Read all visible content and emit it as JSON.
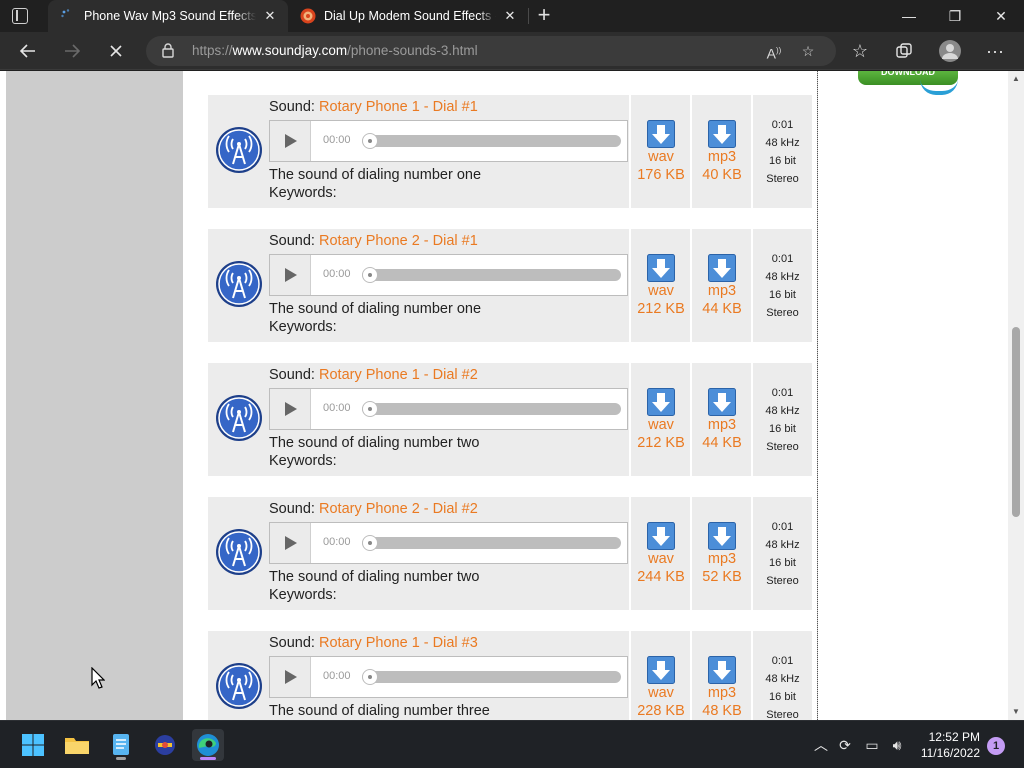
{
  "browser": {
    "tabs": [
      {
        "title": "Phone Wav Mp3 Sound Effects -",
        "active": true
      },
      {
        "title": "Dial Up Modem Sound Effects - ",
        "active": false
      }
    ],
    "close_glyph": "✕",
    "new_tab_glyph": "+",
    "address": {
      "scheme": "https://",
      "host": "www.soundjay.com",
      "path": "/phone-sounds-3.html"
    },
    "window_buttons": {
      "minimize": "—",
      "maximize": "❐",
      "close": "✕"
    }
  },
  "page": {
    "download_badge": "DOWNLOAD",
    "sound_prefix": "Sound: ",
    "keywords_label": "Keywords:",
    "time_display": "00:00",
    "sounds": [
      {
        "name": "Rotary Phone 1 - Dial #1",
        "description": "The sound of dialing number one",
        "wav_label": "wav",
        "wav_size": "176 KB",
        "mp3_label": "mp3",
        "mp3_size": "40 KB",
        "duration": "0:01",
        "rate": "48 kHz",
        "bits": "16 bit",
        "channels": "Stereo"
      },
      {
        "name": "Rotary Phone 2 - Dial #1",
        "description": "The sound of dialing number one",
        "wav_label": "wav",
        "wav_size": "212 KB",
        "mp3_label": "mp3",
        "mp3_size": "44 KB",
        "duration": "0:01",
        "rate": "48 kHz",
        "bits": "16 bit",
        "channels": "Stereo"
      },
      {
        "name": "Rotary Phone 1 - Dial #2",
        "description": "The sound of dialing number two",
        "wav_label": "wav",
        "wav_size": "212 KB",
        "mp3_label": "mp3",
        "mp3_size": "44 KB",
        "duration": "0:01",
        "rate": "48 kHz",
        "bits": "16 bit",
        "channels": "Stereo"
      },
      {
        "name": "Rotary Phone 2 - Dial #2",
        "description": "The sound of dialing number two",
        "wav_label": "wav",
        "wav_size": "244 KB",
        "mp3_label": "mp3",
        "mp3_size": "52 KB",
        "duration": "0:01",
        "rate": "48 kHz",
        "bits": "16 bit",
        "channels": "Stereo"
      },
      {
        "name": "Rotary Phone 1 - Dial #3",
        "description": "The sound of dialing number three",
        "wav_label": "wav",
        "wav_size": "228 KB",
        "mp3_label": "mp3",
        "mp3_size": "48 KB",
        "duration": "0:01",
        "rate": "48 kHz",
        "bits": "16 bit",
        "channels": "Stereo"
      }
    ]
  },
  "taskbar": {
    "time": "12:52 PM",
    "date": "11/16/2022",
    "notification_count": "1",
    "apps": [
      "windows-start-icon",
      "file-explorer-icon",
      "notepad-icon",
      "app-icon",
      "edge-icon"
    ]
  },
  "colors": {
    "link_orange": "#ea7a22",
    "card_bg": "#ececec",
    "page_gray": "#cccccc",
    "browser_dark": "#202020"
  }
}
